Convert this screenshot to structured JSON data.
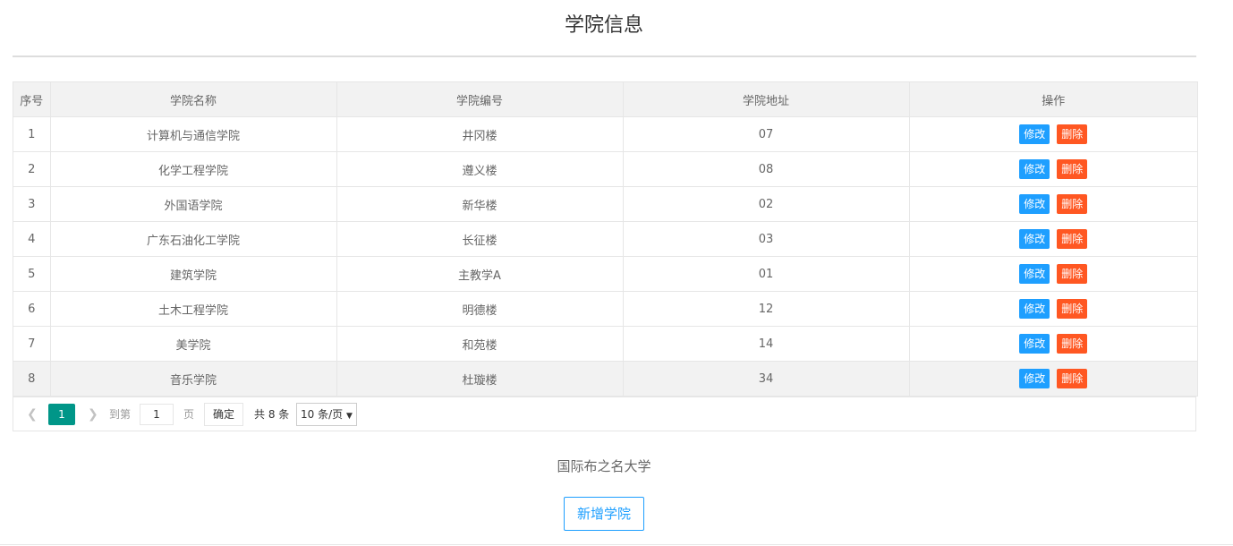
{
  "page_title": "学院信息",
  "table": {
    "headers": [
      "序号",
      "学院名称",
      "学院编号",
      "学院地址",
      "操作"
    ],
    "rows": [
      [
        "1",
        "计算机与通信学院",
        "井冈楼",
        "07"
      ],
      [
        "2",
        "化学工程学院",
        "遵义楼",
        "08"
      ],
      [
        "3",
        "外国语学院",
        "新华楼",
        "02"
      ],
      [
        "4",
        "广东石油化工学院",
        "长征楼",
        "03"
      ],
      [
        "5",
        "建筑学院",
        "主教学A",
        "01"
      ],
      [
        "6",
        "土木工程学院",
        "明德楼",
        "12"
      ],
      [
        "7",
        "美学院",
        "和苑楼",
        "14"
      ],
      [
        "8",
        "音乐学院",
        "杜璇楼",
        "34"
      ]
    ],
    "edit_label": "修改",
    "delete_label": "删除"
  },
  "pager": {
    "prev_icon": "chevron-left-icon",
    "next_icon": "chevron-right-icon",
    "current_page": "1",
    "goto_label": "到第",
    "goto_value": "1",
    "page_unit": "页",
    "confirm_label": "确定",
    "total_label": "共 8 条",
    "per_page_selected": "10 条/页"
  },
  "footer_text": "国际布之名大学",
  "add_button_label": "新增学院"
}
